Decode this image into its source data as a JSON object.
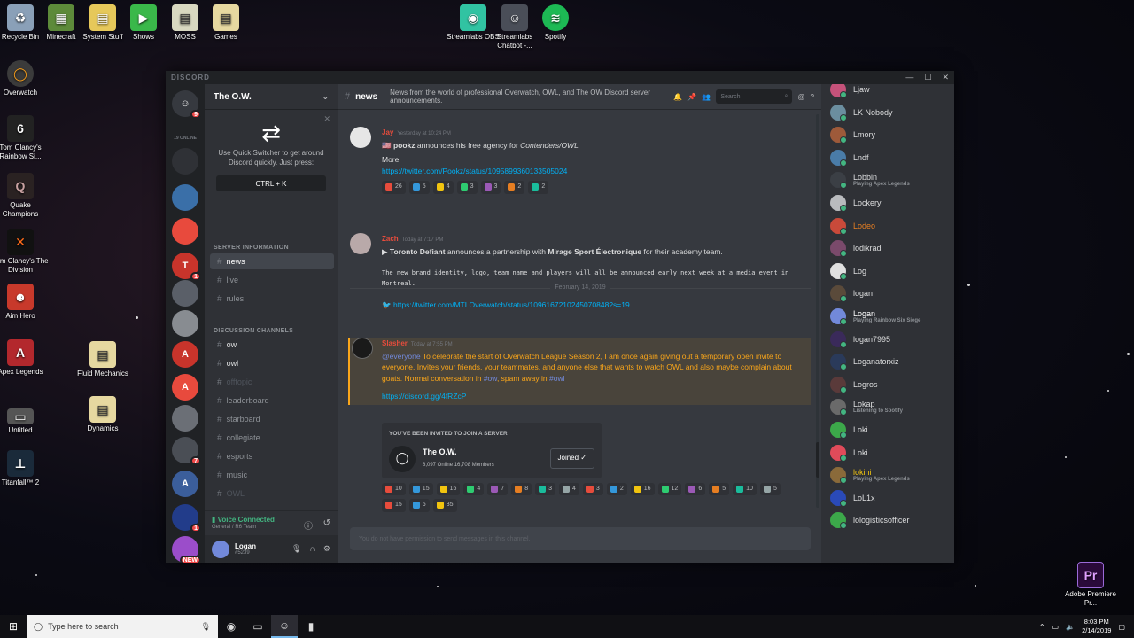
{
  "desktop": {
    "top_icons": [
      "Recycle Bin",
      "Minecraft",
      "System Stuff",
      "Shows",
      "MOSS",
      "Games"
    ],
    "stream_icons": [
      "Streamlabs OBS",
      "Streamlabs Chatbot -...",
      "Spotify"
    ],
    "left_icons": [
      "Overwatch",
      "Tom Clancy's Rainbow Si...",
      "Quake Champions",
      "Tom Clancy's The Division",
      "Aim Hero",
      "Apex Legends",
      "Untitled",
      "Titanfall™ 2"
    ],
    "mid_icons": [
      "Fluid Mechanics",
      "Dynamics"
    ],
    "corner_icon": "Adobe Premiere Pr..."
  },
  "window": {
    "title": "DISCORD",
    "controls": [
      "—",
      "☐",
      "✕"
    ]
  },
  "guilds": {
    "online_count": "19 ONLINE",
    "home_badge": "9",
    "items": [
      {
        "letter": "",
        "color": "#2f3136",
        "badge": ""
      },
      {
        "letter": "",
        "color": "#3a6fa8",
        "badge": ""
      },
      {
        "letter": "",
        "color": "#e84a3d",
        "badge": ""
      },
      {
        "letter": "T",
        "color": "#c8342b",
        "badge": "1"
      },
      {
        "letter": "",
        "color": "#5a5f68",
        "badge": ""
      },
      {
        "letter": "",
        "color": "#888c91",
        "badge": ""
      },
      {
        "letter": "A",
        "color": "#c8342b",
        "badge": ""
      },
      {
        "letter": "A",
        "color": "#e84a3d",
        "badge": ""
      },
      {
        "letter": "",
        "color": "#6b6f76",
        "badge": ""
      },
      {
        "letter": "",
        "color": "#4a4e55",
        "badge": "7"
      },
      {
        "letter": "A",
        "color": "#3b5e9b",
        "badge": ""
      },
      {
        "letter": "",
        "color": "#223c8a",
        "badge": "1"
      },
      {
        "letter": "",
        "color": "#9b4dca",
        "badge": "NEW"
      }
    ]
  },
  "sidebar": {
    "server_name": "The O.W.",
    "tip_text": "Use Quick Switcher to get around Discord quickly. Just press:",
    "shortcut": "CTRL + K",
    "categories": {
      "info": "SERVER INFORMATION",
      "discussion": "DISCUSSION CHANNELS"
    },
    "info_channels": [
      "news",
      "live",
      "rules"
    ],
    "discussion_channels": [
      "ow",
      "owl",
      "offtopic",
      "leaderboard",
      "starboard",
      "collegiate",
      "esports",
      "music",
      "OWL"
    ],
    "voice_status": "Voice Connected",
    "voice_sub": "General / R6 Team",
    "user_name": "Logan",
    "user_tag": "#5239"
  },
  "channel": {
    "name": "news",
    "topic": "News from the world of professional Overwatch, OWL, and The OW Discord server announcements.",
    "search_placeholder": "Search"
  },
  "messages": [
    {
      "author": "Jay",
      "time": "Yesterday at 10:24 PM",
      "text_bold": "pookz",
      "text": " announces his free agency for ",
      "text_italic": "Contenders/OWL",
      "more": "More:",
      "link": "https://twitter.com/Pookz/status/1095899360133505024",
      "reactions": [
        "26",
        "5",
        "4",
        "3",
        "3",
        "2",
        "2"
      ]
    },
    {
      "date_divider": "February 14, 2019",
      "author": "Zach",
      "time": "Today at 7:17 PM",
      "text_bold": "Toronto Defiant",
      "text": " announces a partnership with ",
      "text_bold2": "Mirage Sport Électronique",
      "text_end": " for their academy team.",
      "code": "The new brand identity, logo, team name and players will all be announced early next week at a media event in Montreal.",
      "link": "https://twitter.com/MTLOverwatch/status/1096167210245070848?s=19"
    },
    {
      "author": "Slasher",
      "time": "Today at 7:55 PM",
      "mention": "@everyone",
      "text": " To celebrate the start of ",
      "text2": "Overwatch League Season 2, I am once again giving out a temporary open invite to everyone. Invites your friends, your teammates, and anyone else that wants to watch OWL and also maybe complain about goats. Normal conversation in ",
      "ch1": "#ow",
      "text3": ", spam away in ",
      "ch2": "#owl",
      "link": "https://discord.gg/4fRZcP",
      "invite_label": "YOU'VE BEEN INVITED TO JOIN A SERVER",
      "invite_server": "The O.W.",
      "invite_stats": "8,097 Online   16,708 Members",
      "invite_button": "Joined ✓",
      "reactions": [
        "10",
        "15",
        "16",
        "4",
        "7",
        "8",
        "3",
        "4",
        "3",
        "2",
        "16",
        "12",
        "6",
        "5",
        "10",
        "5",
        "15",
        "6",
        "35"
      ]
    }
  ],
  "composer": {
    "placeholder": "You do not have permission to send messages in this channel."
  },
  "members": [
    {
      "name": "Ljaw",
      "activity": "",
      "color": "#dcddde",
      "av": "#c5527a"
    },
    {
      "name": "LK Nobody",
      "activity": "",
      "color": "#dcddde",
      "av": "#6b8e9f"
    },
    {
      "name": "Lmory",
      "activity": "",
      "color": "#dcddde",
      "av": "#9e5a3a"
    },
    {
      "name": "Lndf",
      "activity": "",
      "color": "#dcddde",
      "av": "#4a7ca8"
    },
    {
      "name": "Lobbin",
      "activity": "Playing Apex Legends",
      "color": "#dcddde",
      "av": "#3b3f45"
    },
    {
      "name": "Lockery",
      "activity": "",
      "color": "#dcddde",
      "av": "#b9bbbe"
    },
    {
      "name": "Lodeo",
      "activity": "",
      "color": "#e67e22",
      "av": "#c94a3a"
    },
    {
      "name": "lodikrad",
      "activity": "",
      "color": "#dcddde",
      "av": "#7a4a6b"
    },
    {
      "name": "Log",
      "activity": "",
      "color": "#dcddde",
      "av": "#e0e0e0"
    },
    {
      "name": "logan",
      "activity": "",
      "color": "#dcddde",
      "av": "#5a4a3a"
    },
    {
      "name": "Logan",
      "activity": "Playing Rainbow Six Siege",
      "color": "#ffffff",
      "av": "#7289da"
    },
    {
      "name": "logan7995",
      "activity": "",
      "color": "#dcddde",
      "av": "#3a2a5a"
    },
    {
      "name": "Loganatorxiz",
      "activity": "",
      "color": "#dcddde",
      "av": "#2a3a5a"
    },
    {
      "name": "Logros",
      "activity": "",
      "color": "#dcddde",
      "av": "#5a3a3a"
    },
    {
      "name": "Lokap",
      "activity": "Listening to Spotify",
      "color": "#dcddde",
      "av": "#6a6a6a"
    },
    {
      "name": "Loki",
      "activity": "",
      "color": "#dcddde",
      "av": "#3ca84a"
    },
    {
      "name": "Loki",
      "activity": "",
      "color": "#dcddde",
      "av": "#e04b5a"
    },
    {
      "name": "lokini",
      "activity": "Playing Apex Legends",
      "color": "#f1c40f",
      "av": "#8a6a3a"
    },
    {
      "name": "LoL1x",
      "activity": "",
      "color": "#dcddde",
      "av": "#2a4ab8"
    },
    {
      "name": "lologisticsofficer",
      "activity": "",
      "color": "#dcddde",
      "av": "#3ca84a"
    }
  ],
  "taskbar": {
    "search_placeholder": "Type here to search",
    "time": "8:03 PM",
    "date": "2/14/2019"
  }
}
